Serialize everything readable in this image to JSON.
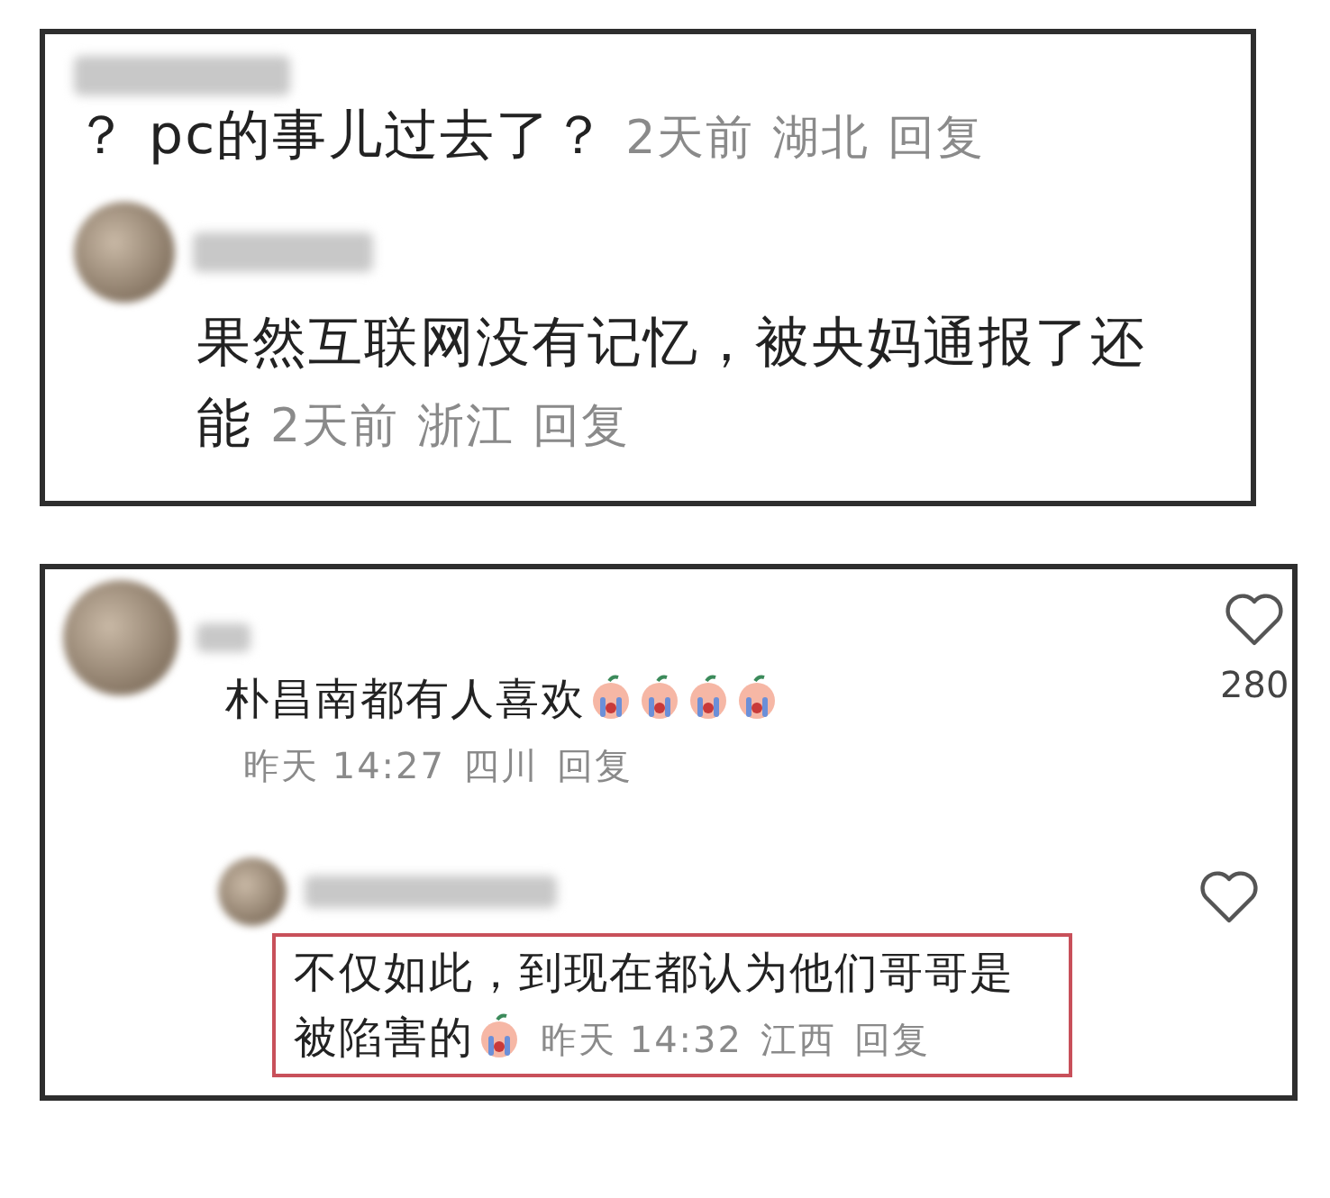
{
  "cards": [
    {
      "comments": [
        {
          "avatar": false,
          "text": "？ pc的事儿过去了？",
          "time": "2天前",
          "location": "湖北",
          "reply": "回复"
        },
        {
          "avatar": true,
          "text": "果然互联网没有记忆，被央妈通报了还能",
          "time": "2天前",
          "location": "浙江",
          "reply": "回复"
        }
      ]
    },
    {
      "comments": [
        {
          "avatar": true,
          "text": "朴昌南都有人喜欢",
          "emojis": [
            {
              "kind": "crying"
            },
            {
              "kind": "crying"
            },
            {
              "kind": "crying"
            },
            {
              "kind": "crying"
            }
          ],
          "time": "昨天 14:27",
          "location": "四川",
          "reply": "回复",
          "likes": "280",
          "replies": [
            {
              "avatar": true,
              "text": "不仅如此，到现在都认为他们哥哥是被陷害的",
              "emojis": [
                {
                  "kind": "crying"
                }
              ],
              "time": "昨天 14:32",
              "location": "江西",
              "reply": "回复",
              "highlighted": true
            }
          ]
        }
      ]
    }
  ]
}
